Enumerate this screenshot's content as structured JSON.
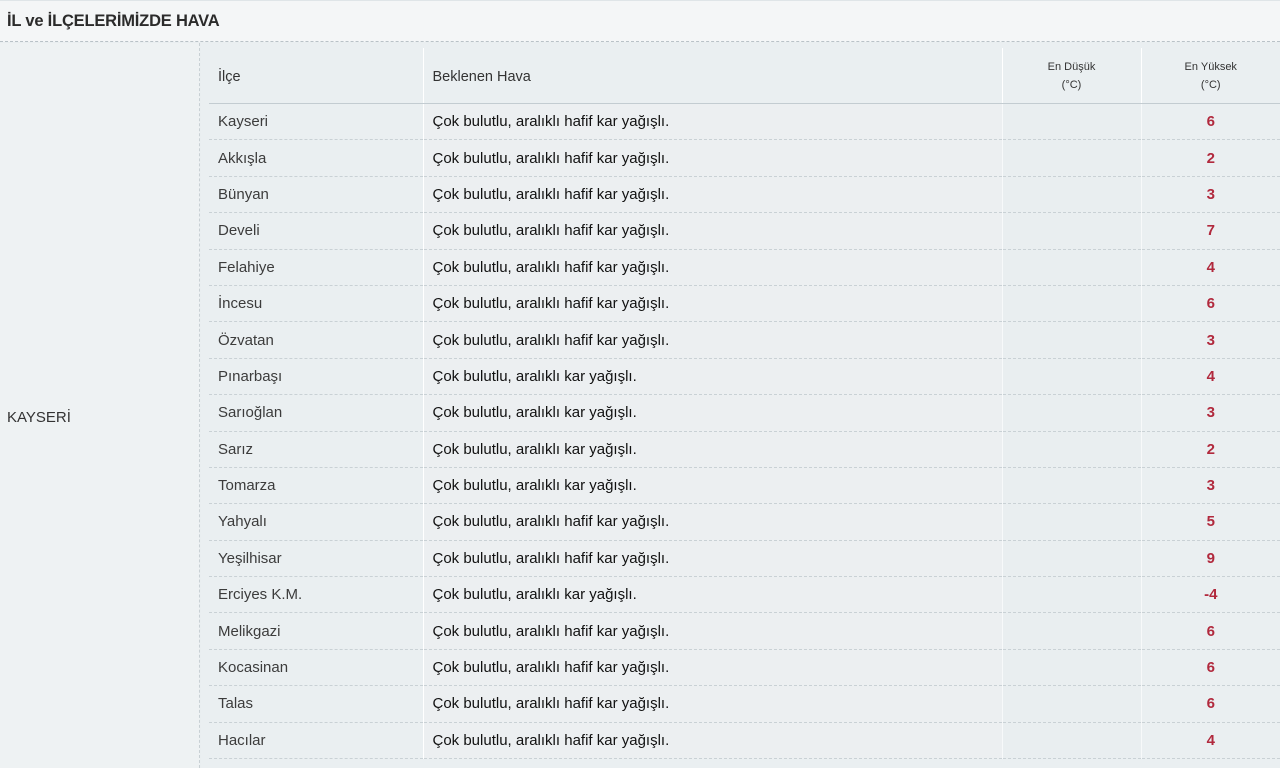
{
  "section": {
    "title": "İL ve İLÇELERİMİZDE HAVA"
  },
  "province": {
    "name": "KAYSERİ"
  },
  "table": {
    "headers": {
      "district": "İlçe",
      "expected_weather": "Beklenen Hava",
      "min_temp_line1": "En Düşük",
      "min_temp_line2": "(°C)",
      "max_temp_line1": "En Yüksek",
      "max_temp_line2": "(°C)"
    },
    "rows": [
      {
        "district": "Kayseri",
        "weather": "Çok bulutlu, aralıklı hafif kar yağışlı.",
        "min": "",
        "max": "6"
      },
      {
        "district": "Akkışla",
        "weather": "Çok bulutlu, aralıklı hafif kar yağışlı.",
        "min": "",
        "max": "2"
      },
      {
        "district": "Bünyan",
        "weather": "Çok bulutlu, aralıklı hafif kar yağışlı.",
        "min": "",
        "max": "3"
      },
      {
        "district": "Develi",
        "weather": "Çok bulutlu, aralıklı hafif kar yağışlı.",
        "min": "",
        "max": "7"
      },
      {
        "district": "Felahiye",
        "weather": "Çok bulutlu, aralıklı hafif kar yağışlı.",
        "min": "",
        "max": "4"
      },
      {
        "district": "İncesu",
        "weather": "Çok bulutlu, aralıklı hafif kar yağışlı.",
        "min": "",
        "max": "6"
      },
      {
        "district": "Özvatan",
        "weather": "Çok bulutlu, aralıklı hafif kar yağışlı.",
        "min": "",
        "max": "3"
      },
      {
        "district": "Pınarbaşı",
        "weather": "Çok bulutlu, aralıklı kar yağışlı.",
        "min": "",
        "max": "4"
      },
      {
        "district": "Sarıoğlan",
        "weather": "Çok bulutlu, aralıklı kar yağışlı.",
        "min": "",
        "max": "3"
      },
      {
        "district": "Sarız",
        "weather": "Çok bulutlu, aralıklı kar yağışlı.",
        "min": "",
        "max": "2"
      },
      {
        "district": "Tomarza",
        "weather": "Çok bulutlu, aralıklı kar yağışlı.",
        "min": "",
        "max": "3"
      },
      {
        "district": "Yahyalı",
        "weather": "Çok bulutlu, aralıklı hafif kar yağışlı.",
        "min": "",
        "max": "5"
      },
      {
        "district": "Yeşilhisar",
        "weather": "Çok bulutlu, aralıklı hafif kar yağışlı.",
        "min": "",
        "max": "9"
      },
      {
        "district": "Erciyes K.M.",
        "weather": "Çok bulutlu, aralıklı kar yağışlı.",
        "min": "",
        "max": "-4"
      },
      {
        "district": "Melikgazi",
        "weather": "Çok bulutlu, aralıklı hafif kar yağışlı.",
        "min": "",
        "max": "6"
      },
      {
        "district": "Kocasinan",
        "weather": "Çok bulutlu, aralıklı hafif kar yağışlı.",
        "min": "",
        "max": "6"
      },
      {
        "district": "Talas",
        "weather": "Çok bulutlu, aralıklı hafif kar yağışlı.",
        "min": "",
        "max": "6"
      },
      {
        "district": "Hacılar",
        "weather": "Çok bulutlu, aralıklı hafif kar yağışlı.",
        "min": "",
        "max": "4"
      }
    ]
  },
  "colors": {
    "max_temp_text": "#b1293d",
    "background": "#e9eef0"
  }
}
